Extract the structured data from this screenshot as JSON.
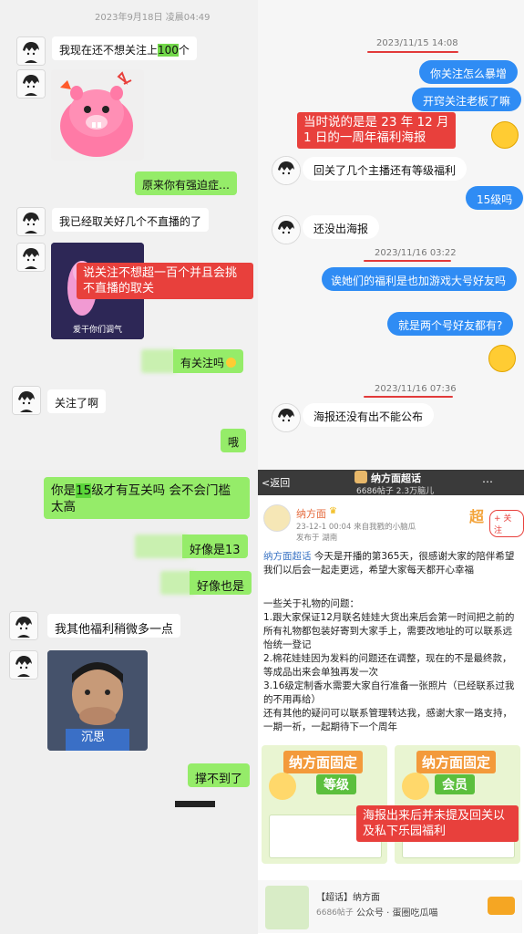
{
  "wechat1": {
    "timestamp": "2023年9月18日 凌晨04:49",
    "msg1_pre": "我现在还不想关注上",
    "msg1_hl": "100",
    "msg1_post": "个",
    "msg2": "原来你有强迫症…",
    "msg3": "我已经取关好几个不直播的了",
    "sticker2_caption": "爱干你们调气",
    "annotation": "说关注不想超一百个并且会挑不直播的取关",
    "msg4": "有关注吗",
    "msg5": "关注了啊",
    "msg6": "哦"
  },
  "qq": {
    "ts1": "2023/11/15 14:08",
    "q1": "你关注怎么暴增",
    "q2": "开窍关注老板了嘛",
    "annotation": "当时说的是是 23 年 12 月 1 日的一周年福利海报",
    "r1": "回关了几个主播还有等级福利",
    "q3": "15级吗",
    "r2": "还没出海报",
    "ts2": "2023/11/16 03:22",
    "q4": "诶她们的福利是也加游戏大号好友吗",
    "q5": "就是两个号好友都有?",
    "ts3": "2023/11/16 07:36",
    "r3": "海报还没有出不能公布"
  },
  "wechat2": {
    "m1_pre": "你是",
    "m1_hl": "15",
    "m1_post": "级才有互关吗 会不会门槛太高",
    "m2": "好像是13",
    "m3": "好像也是",
    "m4": "我其他福利稍微多一点",
    "sticker_caption": "沉思",
    "m5": "撑不到了"
  },
  "weibo": {
    "back": "返回",
    "title": "纳方面超话",
    "stats": "6686帖子 2.3万脑儿",
    "username": "纳方面",
    "date_line": "23-12-1 00:04  来自我戳的小脑瓜",
    "location": "发布于 湖南",
    "follow": "+ 关注",
    "p1_tag": "纳方面超话",
    "p1": " 今天是开播的第365天，很感谢大家的陪伴希望我们以后会一起走更远，希望大家每天都开心幸福",
    "p2": "一些关于礼物的问题：",
    "p3": "1.跟大家保证12月联名娃娃大货出来后会第一时间把之前的所有礼物都包装好寄到大家手上，需要改地址的可以联系远怡统一登记",
    "p4": "2.棉花娃娃因为发料的问题还在调整，现在的不是最终款，等成品出来会单独再发一次",
    "p5": "3.16级定制香水需要大家自行准备一张照片（已经联系过我的不用再给）",
    "p6": "还有其他的疑问可以联系管理转达我，感谢大家一路支持，一期一祈，一起期待下一个周年",
    "poster_left_title": "纳方面固定",
    "poster_left_sub": "等级",
    "poster_right_title": "纳方面固定",
    "poster_right_sub": "会员",
    "annotation": "海报出来后并未提及回关以及私下乐园福利",
    "card_title": "【超话】纳方面",
    "card_stats": "6686帖子",
    "watermark": "公众号 · 蛋圈吃瓜喵"
  },
  "colors": {
    "wechat_green": "#95ec69",
    "qq_blue": "#2f8cf4",
    "annotation_red": "#e8403c"
  }
}
